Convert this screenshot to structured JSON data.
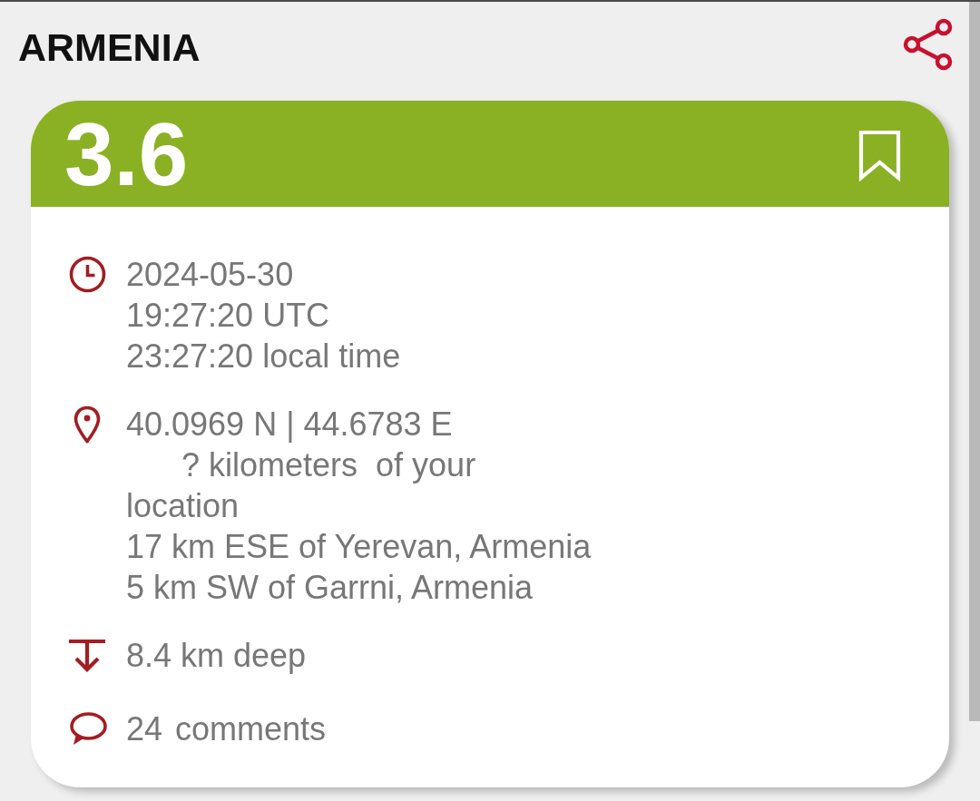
{
  "header": {
    "title": "ARMENIA"
  },
  "quake": {
    "magnitude": "3.6",
    "bookmarked": false,
    "details": [
      {
        "kind": "time",
        "lines": [
          "2024-05-30",
          "19:27:20 UTC",
          "23:27:20 local time"
        ]
      },
      {
        "kind": "location",
        "coordinates": "40.0969 N | 44.6783 E",
        "distance": "? kilometers  of your location",
        "places": [
          "17 km ESE of Yerevan, Armenia",
          "5 km SW of Garrni, Armenia"
        ]
      },
      {
        "kind": "depth",
        "lines": [
          "8.4 km deep"
        ]
      },
      {
        "kind": "comments",
        "count": "24",
        "label": "comments"
      }
    ]
  }
}
